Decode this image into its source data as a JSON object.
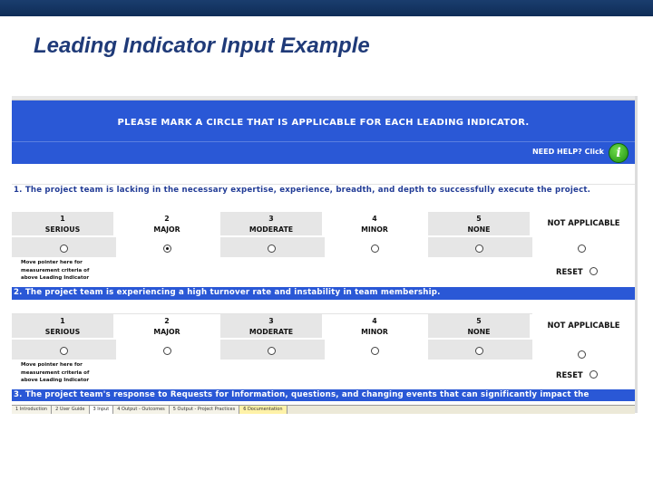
{
  "slide": {
    "title": "Leading Indicator Input Example"
  },
  "sheet": {
    "banner": "PLEASE MARK A CIRCLE THAT IS APPLICABLE FOR EACH LEADING INDICATOR.",
    "help": {
      "text": "NEED HELP?  Click",
      "icon": "i"
    },
    "options": [
      {
        "num": "1",
        "label": "SERIOUS"
      },
      {
        "num": "2",
        "label": "MAJOR"
      },
      {
        "num": "3",
        "label": "MODERATE"
      },
      {
        "num": "4",
        "label": "MINOR"
      },
      {
        "num": "5",
        "label": "NONE"
      }
    ],
    "not_applicable": "NOT APPLICABLE",
    "pointer_note": [
      "Move pointer here for",
      "measurement criteria of",
      "above Leading Indicator"
    ],
    "reset_label": "RESET",
    "questions": [
      {
        "text": "1. The project team is lacking in the necessary expertise, experience, breadth, and depth to successfully execute the project.",
        "selected": 1
      },
      {
        "text": "2. The project team is experiencing a high turnover rate and instability in team membership.",
        "selected": -1
      },
      {
        "text": "3. The project team's response to Requests for Information, questions, and changing events that can significantly impact the"
      }
    ],
    "tabs": [
      "1 Introduction",
      "2 User Guide",
      "3 Input",
      "4 Output - Outcomes",
      "5 Output - Project Practices",
      "6 Documentation"
    ]
  }
}
